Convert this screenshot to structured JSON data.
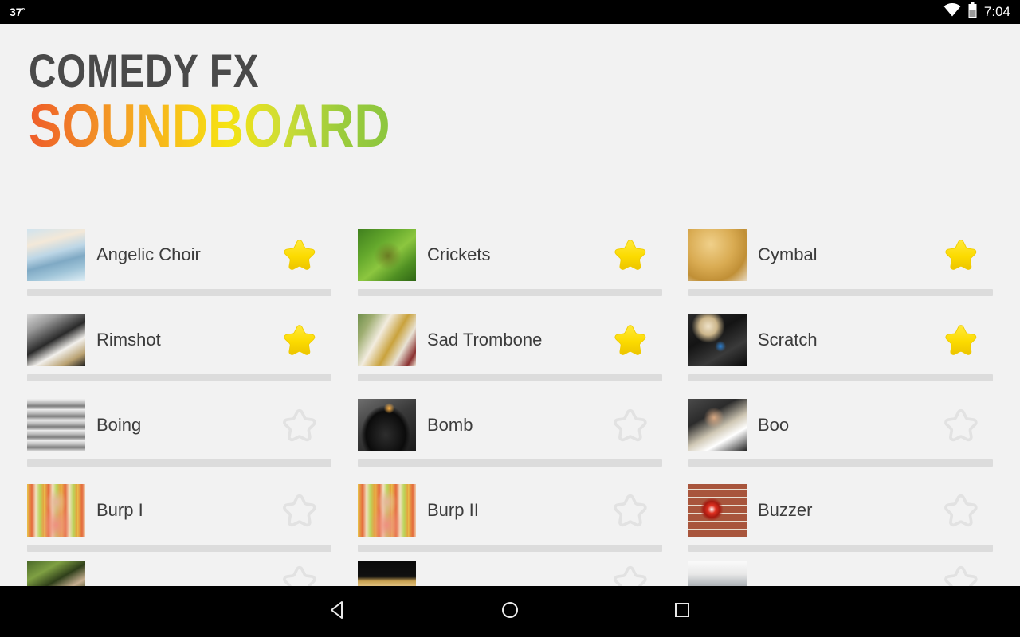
{
  "status_bar": {
    "temperature": "37",
    "degree_symbol": "º",
    "time": "7:04",
    "wifi_icon": "wifi-icon",
    "battery_icon": "battery-icon"
  },
  "header": {
    "title_line1": "COMEDY FX",
    "title_line2": "SOUNDBOARD",
    "title_line1_color": "#4a4a4a",
    "gradient_start": "#ef5d2a",
    "gradient_end": "#8cc63f"
  },
  "colors": {
    "background": "#f2f2f2",
    "divider": "#dcdcdc",
    "star_filled": "#fcdb00",
    "star_empty": "#e2e2e2",
    "label_text": "#3c3c3c",
    "status_bar": "#000000"
  },
  "sounds": [
    {
      "name": "Angelic Choir",
      "favorite": true,
      "thumb": "clouds-sky-thumb"
    },
    {
      "name": "Crickets",
      "favorite": true,
      "thumb": "cricket-leaf-thumb"
    },
    {
      "name": "Cymbal",
      "favorite": true,
      "thumb": "cymbal-thumb"
    },
    {
      "name": "Rimshot",
      "favorite": true,
      "thumb": "drum-kit-thumb"
    },
    {
      "name": "Sad Trombone",
      "favorite": true,
      "thumb": "marching-band-thumb"
    },
    {
      "name": "Scratch",
      "favorite": true,
      "thumb": "turntable-thumb"
    },
    {
      "name": "Boing",
      "favorite": false,
      "thumb": "springs-thumb"
    },
    {
      "name": "Bomb",
      "favorite": false,
      "thumb": "bomb-thumb"
    },
    {
      "name": "Boo",
      "favorite": false,
      "thumb": "thumbs-down-man-thumb"
    },
    {
      "name": "Burp I",
      "favorite": false,
      "thumb": "woman-stripes-thumb"
    },
    {
      "name": "Burp II",
      "favorite": false,
      "thumb": "woman-stripes-thumb"
    },
    {
      "name": "Buzzer",
      "favorite": false,
      "thumb": "red-alarm-brick-thumb"
    },
    {
      "name": "",
      "favorite": false,
      "thumb": "forest-partial-thumb"
    },
    {
      "name": "",
      "favorite": false,
      "thumb": "dark-gold-partial-thumb"
    },
    {
      "name": "",
      "favorite": false,
      "thumb": "white-gray-partial-thumb"
    }
  ],
  "nav_bar": {
    "back_label": "back-icon",
    "home_label": "home-icon",
    "recents_label": "recents-icon"
  }
}
